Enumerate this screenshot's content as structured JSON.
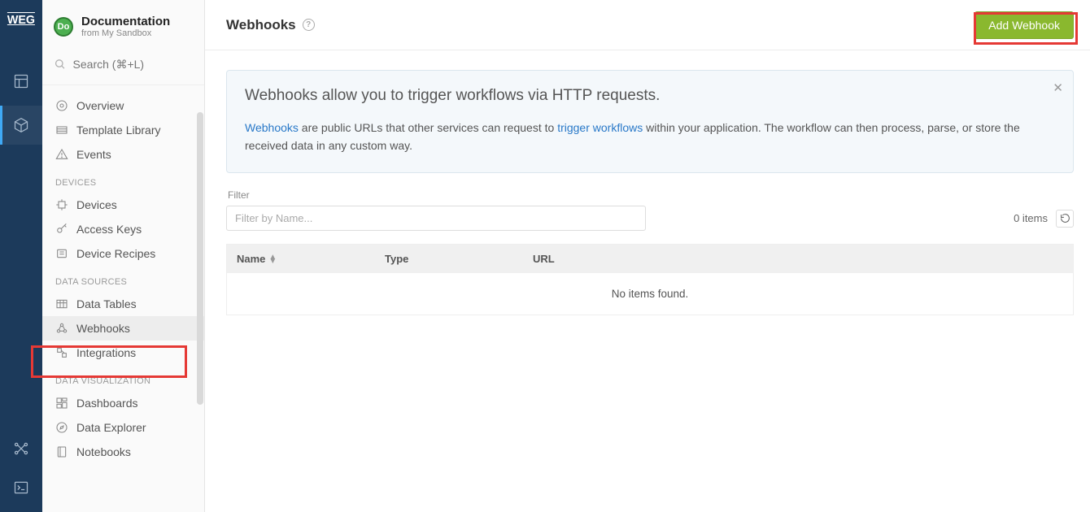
{
  "rail": {
    "logo_text": "WEG"
  },
  "sidebar": {
    "avatar_initials": "Do",
    "title": "Documentation",
    "subtitle": "from My Sandbox",
    "search_placeholder": "Search (⌘+L)",
    "groups": [
      {
        "label": null,
        "items": [
          {
            "icon": "eye-icon",
            "label": "Overview"
          },
          {
            "icon": "template-icon",
            "label": "Template Library"
          },
          {
            "icon": "alert-icon",
            "label": "Events"
          }
        ]
      },
      {
        "label": "DEVICES",
        "items": [
          {
            "icon": "chip-icon",
            "label": "Devices"
          },
          {
            "icon": "key-icon",
            "label": "Access Keys"
          },
          {
            "icon": "recipe-icon",
            "label": "Device Recipes"
          }
        ]
      },
      {
        "label": "DATA SOURCES",
        "items": [
          {
            "icon": "table-icon",
            "label": "Data Tables"
          },
          {
            "icon": "webhook-icon",
            "label": "Webhooks",
            "active": true
          },
          {
            "icon": "integrations-icon",
            "label": "Integrations"
          }
        ]
      },
      {
        "label": "DATA VISUALIZATION",
        "items": [
          {
            "icon": "dashboard-icon",
            "label": "Dashboards"
          },
          {
            "icon": "compass-icon",
            "label": "Data Explorer"
          },
          {
            "icon": "notebook-icon",
            "label": "Notebooks"
          }
        ]
      }
    ]
  },
  "page": {
    "title": "Webhooks",
    "add_button": "Add Webhook",
    "info": {
      "heading": "Webhooks allow you to trigger workflows via HTTP requests.",
      "link1": "Webhooks",
      "text1": " are public URLs that other services can request to ",
      "link2": "trigger workflows",
      "text2": " within your application. The workflow can then process, parse, or store the received data in any custom way."
    },
    "filter_label": "Filter",
    "filter_placeholder": "Filter by Name...",
    "items_count": "0 items",
    "table": {
      "col_name": "Name",
      "col_type": "Type",
      "col_url": "URL",
      "empty": "No items found."
    }
  }
}
